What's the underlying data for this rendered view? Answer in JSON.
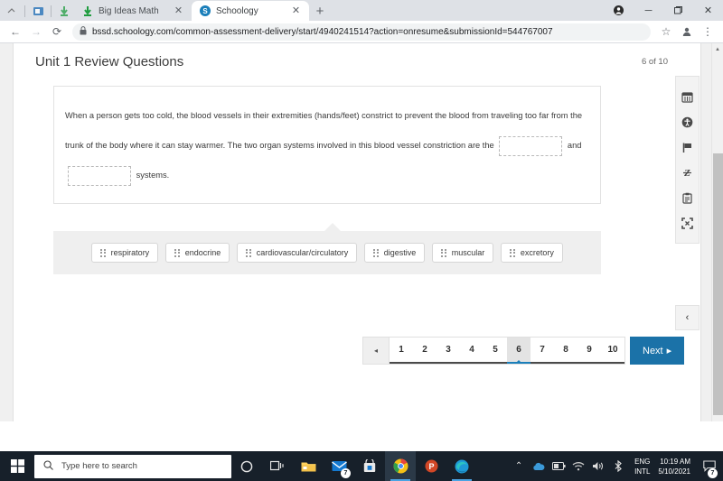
{
  "browser": {
    "tabs": [
      {
        "title": "Big Ideas Math",
        "favicon": "green-arrow-icon",
        "active": false
      },
      {
        "title": "Schoology",
        "favicon": "schoology-s-icon",
        "active": true
      }
    ],
    "new_tab_label": "+",
    "window_controls": {
      "profile": "●",
      "minimize": "─",
      "maximize": "❐",
      "close": "✕"
    },
    "nav": {
      "back": "←",
      "forward": "→",
      "reload": "⟳"
    },
    "omnibox": {
      "lock_icon": "lock-icon",
      "host": "bssd.schoology.com",
      "path": "/common-assessment-delivery/start/4940241514?action=onresume&submissionId=544767007",
      "full_url": "bssd.schoology.com/common-assessment-delivery/start/4940241514?action=onresume&submissionId=544767007",
      "star": "☆",
      "profile": "●",
      "menu": "⋮"
    }
  },
  "assessment": {
    "title": "Unit 1 Review Questions",
    "progress": "6 of 10",
    "question": {
      "line1": "When a person gets too cold, the blood vessels in their extremities (hands/feet) constrict to prevent the blood from traveling too far from the",
      "line2a": "trunk of the body where it can stay warmer. The two organ systems involved in this blood vessel constriction are the",
      "line2b": "and",
      "line3": "systems.",
      "blank1_value": "",
      "blank2_value": ""
    },
    "answer_bank": [
      {
        "label": "respiratory"
      },
      {
        "label": "endocrine"
      },
      {
        "label": "cardiovascular/circulatory"
      },
      {
        "label": "digestive"
      },
      {
        "label": "muscular"
      },
      {
        "label": "excretory"
      }
    ],
    "pagination": {
      "prev_label": "◂",
      "pages": [
        "1",
        "2",
        "3",
        "4",
        "5",
        "6",
        "7",
        "8",
        "9",
        "10"
      ],
      "current_page": "6",
      "next_label": "Next",
      "next_arrow": "▸",
      "accent_color": "#1b72a8"
    },
    "tool_rail": [
      {
        "icon": "calendar-icon"
      },
      {
        "icon": "accessibility-icon"
      },
      {
        "icon": "flag-icon"
      },
      {
        "icon": "strikethrough-z-icon"
      },
      {
        "icon": "clipboard-icon"
      },
      {
        "icon": "fullscreen-icon"
      }
    ],
    "rail_collapse_label": "‹"
  },
  "taskbar": {
    "start_label": "start-icon",
    "search_placeholder": "Type here to search",
    "search_icon": "search-icon",
    "items": [
      {
        "name": "cortana-icon"
      },
      {
        "name": "task-view-icon"
      },
      {
        "name": "file-explorer-icon"
      },
      {
        "name": "mail-icon",
        "badge": "7"
      },
      {
        "name": "microsoft-store-icon"
      },
      {
        "name": "google-chrome-icon"
      },
      {
        "name": "powerpoint-icon"
      },
      {
        "name": "microsoft-edge-icon"
      }
    ],
    "tray": {
      "show_hidden": "⌃",
      "onedrive": "onedrive-icon",
      "battery": "battery-icon",
      "wifi": "wifi-icon",
      "volume": "volume-icon",
      "bluetooth": "bluetooth-icon",
      "language_line1": "ENG",
      "language_line2": "INTL",
      "time": "10:19 AM",
      "date": "5/10/2021",
      "notification_badge": "7"
    }
  }
}
